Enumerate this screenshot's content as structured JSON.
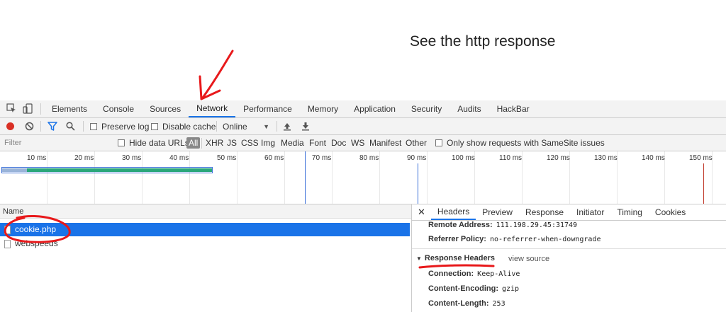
{
  "caption": "See the http response",
  "devtools": {
    "tabs": [
      "Elements",
      "Console",
      "Sources",
      "Network",
      "Performance",
      "Memory",
      "Application",
      "Security",
      "Audits",
      "HackBar"
    ],
    "active_tab": "Network"
  },
  "toolbar": {
    "preserve_log": "Preserve log",
    "disable_cache": "Disable cache",
    "throttle": "Online"
  },
  "filter": {
    "placeholder": "Filter",
    "hide_data_urls": "Hide data URLs",
    "types": [
      "All",
      "XHR",
      "JS",
      "CSS",
      "Img",
      "Media",
      "Font",
      "Doc",
      "WS",
      "Manifest",
      "Other"
    ],
    "samesite": "Only show requests with SameSite issues"
  },
  "timeline": {
    "ticks": [
      "10 ms",
      "20 ms",
      "30 ms",
      "40 ms",
      "50 ms",
      "60 ms",
      "70 ms",
      "80 ms",
      "90 ms",
      "100 ms",
      "110 ms",
      "120 ms",
      "130 ms",
      "140 ms",
      "150 ms"
    ]
  },
  "requests": {
    "header": "Name",
    "rows": [
      "cookie.php",
      "webspeeds"
    ]
  },
  "detail": {
    "tabs": [
      "Headers",
      "Preview",
      "Response",
      "Initiator",
      "Timing",
      "Cookies"
    ],
    "remote_address_key": "Remote Address:",
    "remote_address_val": "111.198.29.45:31749",
    "referrer_policy_key": "Referrer Policy:",
    "referrer_policy_val": "no-referrer-when-downgrade",
    "response_headers": "Response Headers",
    "view_source": "view source",
    "headers": [
      {
        "k": "Connection:",
        "v": "Keep-Alive"
      },
      {
        "k": "Content-Encoding:",
        "v": "gzip"
      },
      {
        "k": "Content-Length:",
        "v": "253"
      }
    ]
  },
  "colors": {
    "accent": "#1a73e8",
    "annotation": "#e8191b",
    "record": "#d93025"
  }
}
